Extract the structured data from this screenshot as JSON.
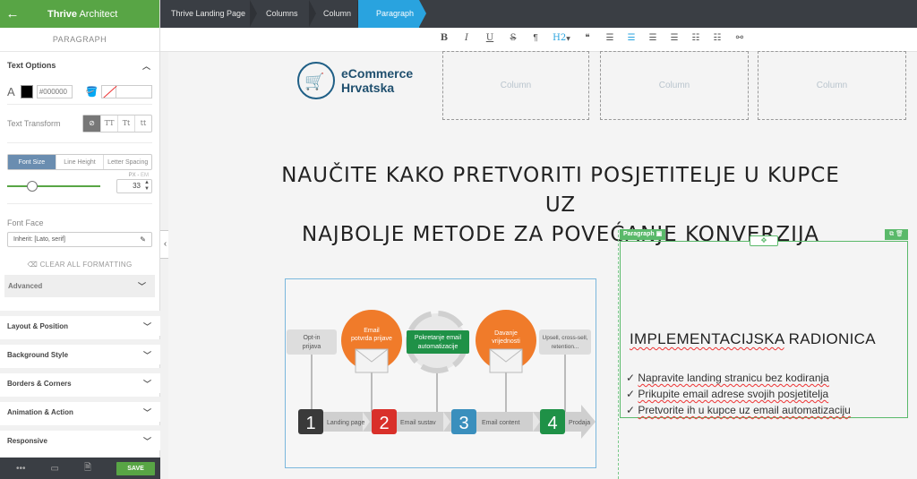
{
  "sidebar": {
    "app_title_bold": "Thrive",
    "app_title_rest": " Architect",
    "back_icon": "arrow-left-icon",
    "element_label": "PARAGRAPH",
    "text_options": {
      "title": "Text Options",
      "color_hex": "#000000",
      "text_color": "#000000",
      "text_transform_label": "Text Transform",
      "transform_options": [
        "TT",
        "Tt",
        "tt"
      ],
      "size_tabs": [
        "Font Size",
        "Line Height",
        "Letter Spacing"
      ],
      "unit_px": "PX",
      "unit_sep": " - ",
      "unit_em": "EM",
      "font_size_value": "33",
      "font_size_level": 0.27,
      "font_face_label": "Font Face",
      "font_face_value": "Inherit: [Lato, serif]",
      "clear_formatting": "CLEAR ALL FORMATTING",
      "advanced": "Advanced"
    },
    "sections": [
      "Layout & Position",
      "Background Style",
      "Borders & Corners",
      "Animation & Action",
      "Responsive"
    ],
    "footer": {
      "save_label": "SAVE"
    }
  },
  "breadcrumb": [
    "Thrive Landing Page",
    "Columns",
    "Column",
    "Paragraph"
  ],
  "toolbar": {
    "bold": "B",
    "italic": "I",
    "underline": "U",
    "strike": "S",
    "paragraph": "¶",
    "heading": "H2",
    "quote": "❝"
  },
  "canvas": {
    "logo_line1": "eCommerce",
    "logo_line2": "Hrvatska",
    "column_placeholder": "Column",
    "headline_line1": "NAUČITE KAKO PRETVORITI POSJETITELJE U KUPCE UZ",
    "headline_line2": "NAJBOLJE METODE ZA POVEĆANJE KONVERZIJA",
    "paragraph_tag": "Paragraph",
    "para_title_a": "IMPLEMENTACIJSKA",
    "para_title_b": "RADIONICA",
    "bullets": [
      {
        "check": "✓ ",
        "text": "Napravite landing stranicu bez kodiranja"
      },
      {
        "check": "✓ ",
        "text": "Prikupite email adrese svojih posjetitelja"
      },
      {
        "check": "✓ ",
        "text": "Pretvorite ih u kupce uz email automatizaciju"
      }
    ],
    "funnel": {
      "stage_optin": [
        "Opt-in",
        "prijava"
      ],
      "stage_email": [
        "Email",
        "potvrda prijave"
      ],
      "stage_auto": [
        "Pokretanje email",
        "automatizacije"
      ],
      "stage_value": [
        "Davanje",
        "vrijednosti"
      ],
      "stage_upsell": [
        "Upsell, cross-sell,",
        "retention..."
      ],
      "steps": [
        {
          "num": "1",
          "label": "Landing page",
          "color": "#3a3a3a"
        },
        {
          "num": "2",
          "label": "Email sustav",
          "color": "#d9302a"
        },
        {
          "num": "3",
          "label": "Email content",
          "color": "#3a8fbd"
        },
        {
          "num": "4",
          "label": "Prodaja",
          "color": "#1f9147"
        }
      ],
      "orange": "#f07b2a",
      "green": "#1f9147"
    }
  }
}
